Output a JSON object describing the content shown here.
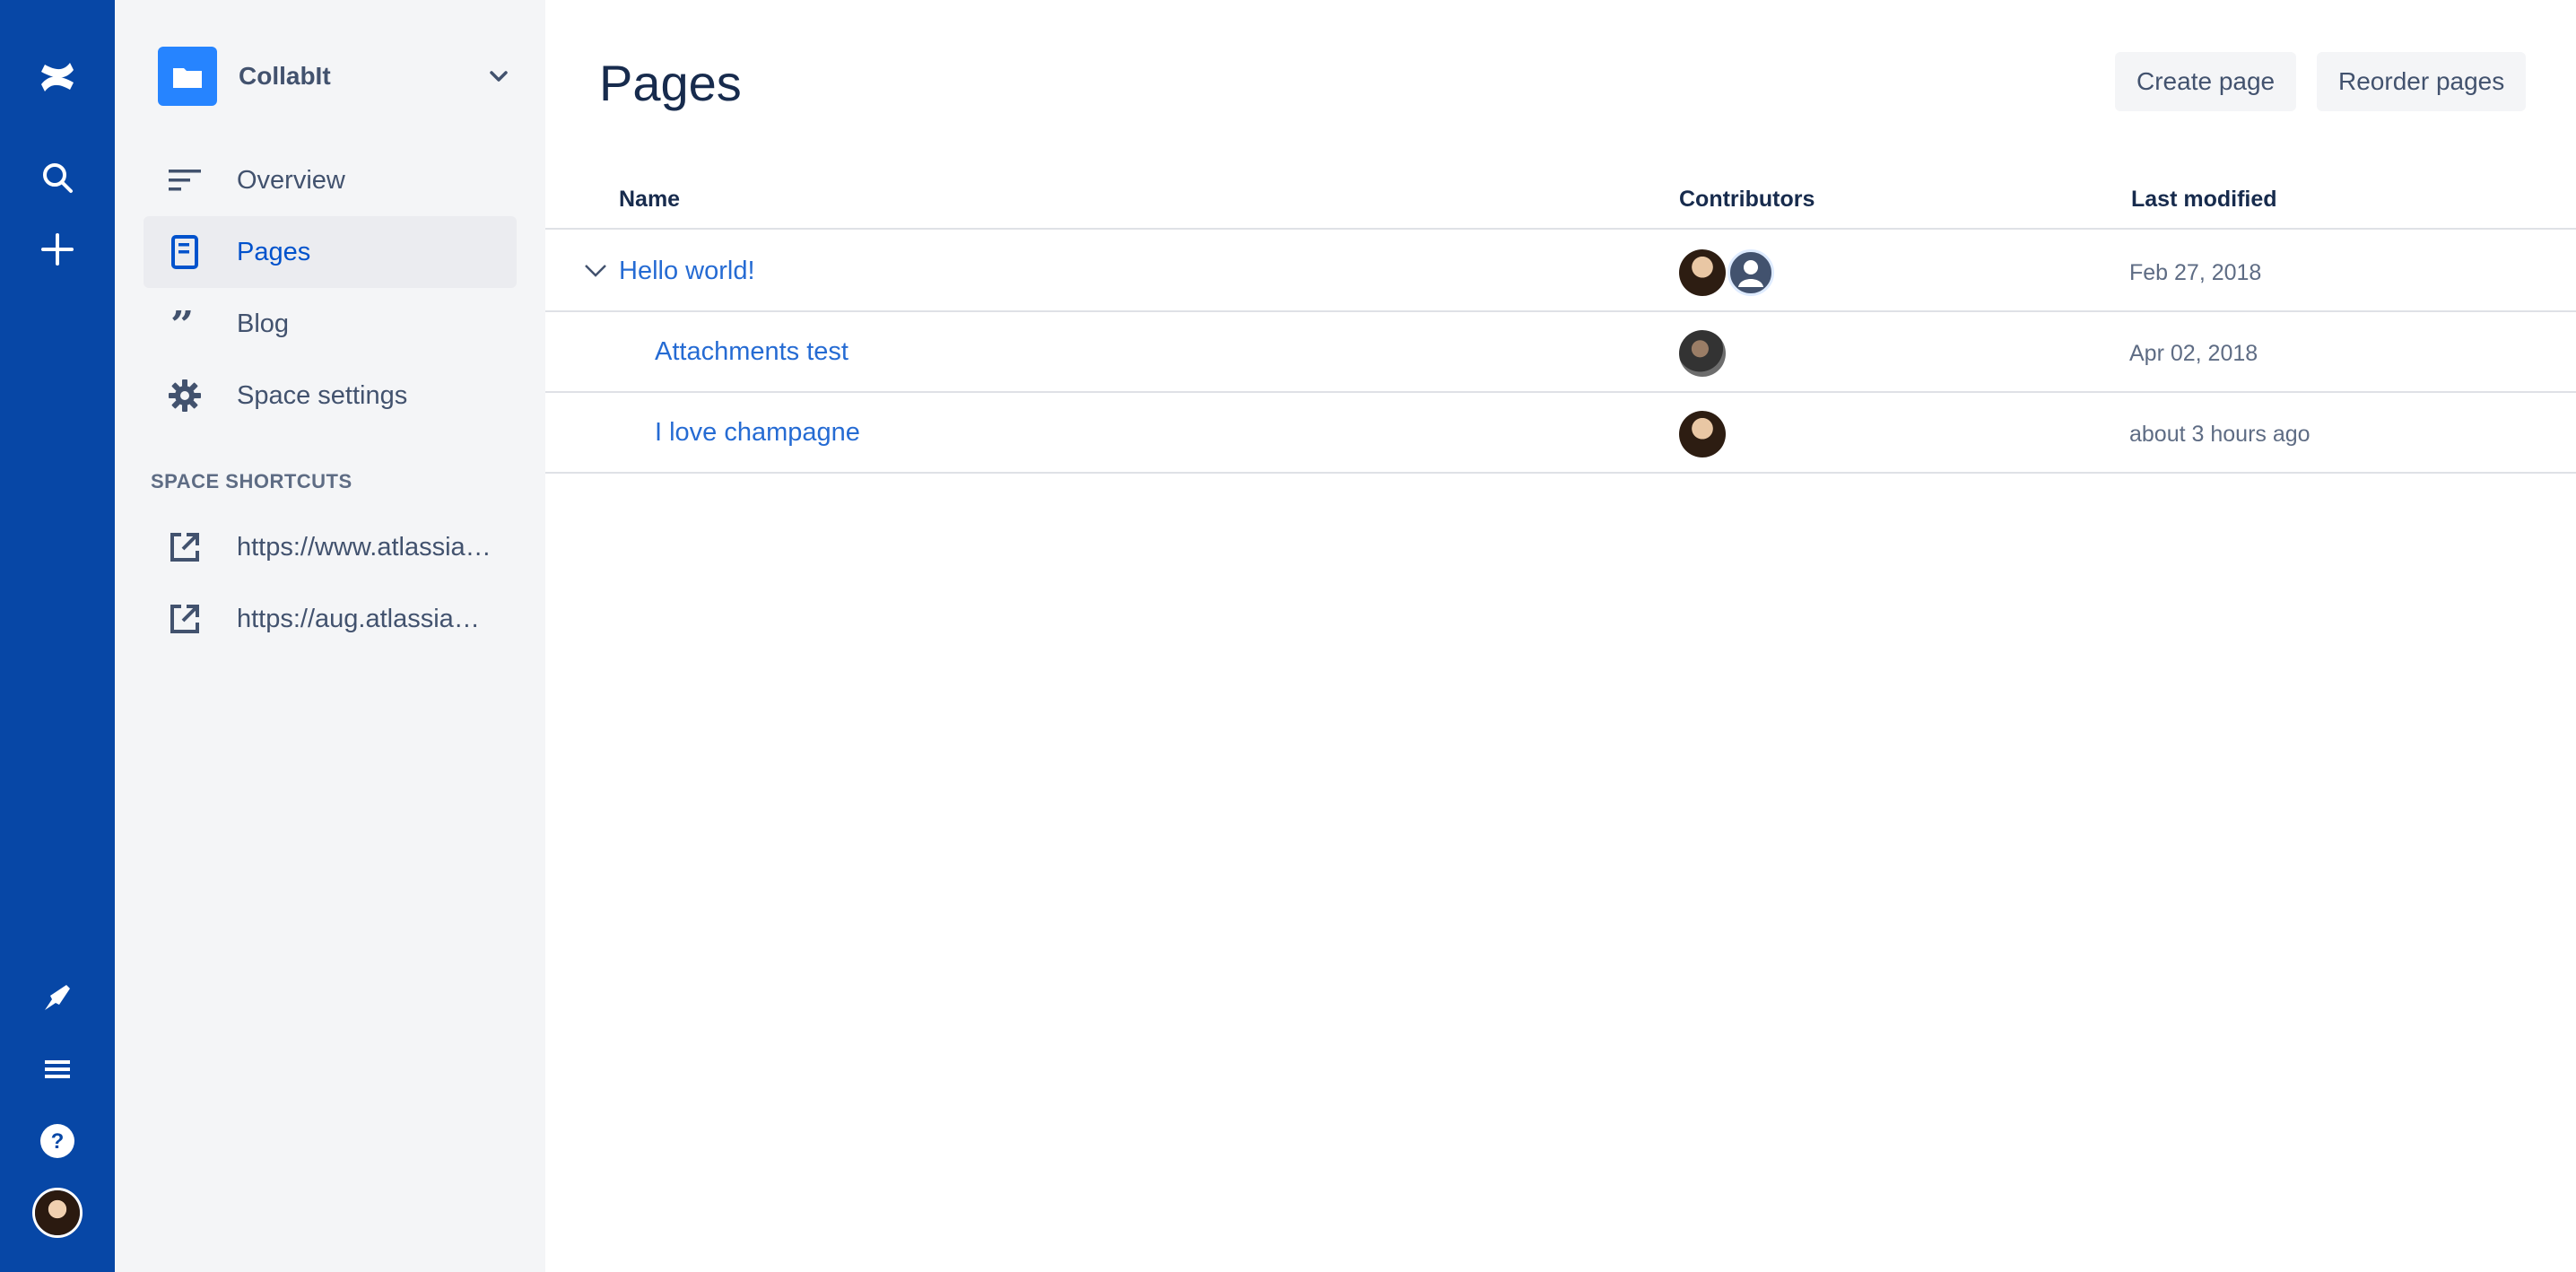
{
  "global_nav": {
    "icons": [
      "confluence-logo-icon",
      "search-icon",
      "create-icon",
      "notifications-icon",
      "menu-icon",
      "help-icon"
    ],
    "accent": "#0747A6"
  },
  "space": {
    "name": "CollabIt",
    "logo_color": "#2684FF"
  },
  "sidebar": {
    "items": [
      {
        "label": "Overview",
        "icon": "overview-icon",
        "active": false
      },
      {
        "label": "Pages",
        "icon": "pages-icon",
        "active": true
      },
      {
        "label": "Blog",
        "icon": "blog-quote-icon",
        "active": false
      },
      {
        "label": "Space settings",
        "icon": "gear-icon",
        "active": false
      }
    ],
    "shortcuts_title": "SPACE SHORTCUTS",
    "shortcuts": [
      {
        "label": "https://www.atlassian.com",
        "icon": "external-link-icon"
      },
      {
        "label": "https://aug.atlassian.com",
        "icon": "external-link-icon"
      }
    ]
  },
  "main": {
    "title": "Pages",
    "buttons": {
      "create": "Create page",
      "reorder": "Reorder pages"
    },
    "table": {
      "headers": {
        "name": "Name",
        "contributors": "Contributors",
        "modified": "Last modified"
      },
      "rows": [
        {
          "name": "Hello world!",
          "modified": "Feb 27, 2018",
          "expanded": true
        },
        {
          "name": "Attachments test",
          "modified": "Apr 02, 2018"
        },
        {
          "name": "I love champagne",
          "modified": "about 3 hours ago"
        }
      ]
    }
  }
}
